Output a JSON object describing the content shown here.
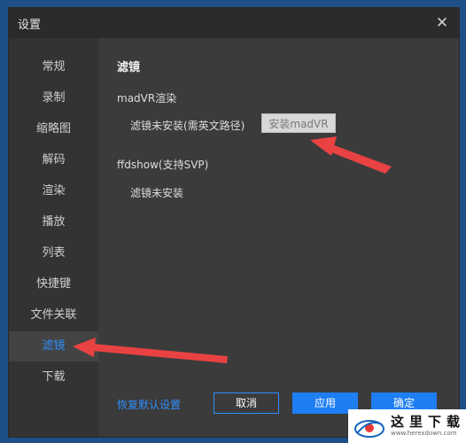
{
  "window": {
    "title": "设置",
    "close_icon": "close-icon"
  },
  "sidebar": {
    "items": [
      {
        "label": "常规"
      },
      {
        "label": "录制"
      },
      {
        "label": "缩略图"
      },
      {
        "label": "解码"
      },
      {
        "label": "渲染"
      },
      {
        "label": "播放"
      },
      {
        "label": "列表"
      },
      {
        "label": "快捷键"
      },
      {
        "label": "文件关联"
      },
      {
        "label": "滤镜",
        "active": true
      },
      {
        "label": "下载"
      }
    ]
  },
  "content": {
    "section_title": "滤镜",
    "madvr": {
      "label": "madVR渲染",
      "status": "滤镜未安装(需英文路径)",
      "install_button": "安装madVR"
    },
    "ffdshow": {
      "label": "ffdshow(支持SVP)",
      "status": "滤镜未安装"
    }
  },
  "footer": {
    "restore_link": "恢复默认设置",
    "cancel": "取消",
    "apply": "应用",
    "ok": "确定"
  },
  "watermark": {
    "title": "这里下载",
    "url": "www.herexdown.com"
  },
  "colors": {
    "accent": "#1e7ef3",
    "arrow": "#e94242",
    "window_bg": "#3b3b3b"
  }
}
